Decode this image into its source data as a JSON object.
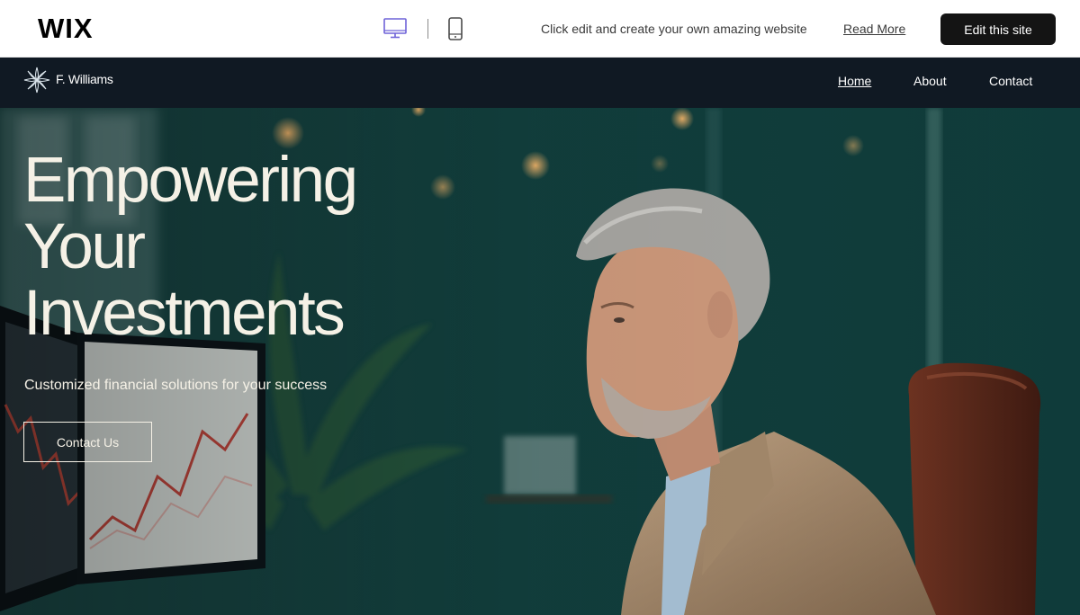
{
  "wix_bar": {
    "logo": "WIX",
    "devices": [
      {
        "name": "desktop",
        "icon": "desktop-monitor-icon",
        "active": true,
        "color": "#6f63d8"
      },
      {
        "name": "mobile",
        "icon": "mobile-phone-icon",
        "active": false,
        "color": "#4a4a4a"
      }
    ],
    "promo_text": "Click edit and create your own amazing website",
    "read_more_label": "Read More",
    "edit_button_label": "Edit this site"
  },
  "site": {
    "brand_icon": "star-flower-logo-icon",
    "brand_name": "F. Williams",
    "nav": [
      {
        "label": "Home",
        "active": true
      },
      {
        "label": "About",
        "active": false
      },
      {
        "label": "Contact",
        "active": false
      }
    ]
  },
  "hero": {
    "title_lines": [
      "Empowering",
      "Your",
      "Investments"
    ],
    "subtitle": "Customized financial solutions for your success",
    "cta_label": "Contact Us",
    "image": "photo-of-grey-haired-man-in-beige-blazer-at-desk-with-trading-monitors"
  },
  "colors": {
    "header_bg": "#101923",
    "hero_bg": "#12403e",
    "hero_text": "#f5f1e6",
    "edit_button_bg": "#141414",
    "desktop_icon_active": "#6f63d8"
  }
}
